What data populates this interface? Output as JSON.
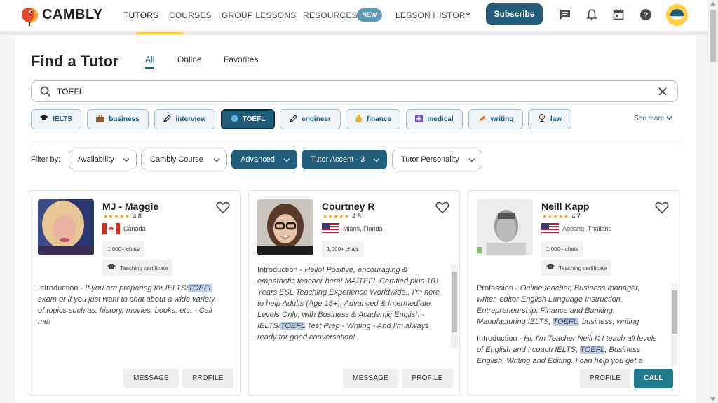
{
  "brand": {
    "name": "CAMBLY",
    "accent": "#1f5d7b",
    "yellow": "#ffce43"
  },
  "nav": {
    "items": [
      "TUTORS",
      "COURSES",
      "GROUP LESSONS",
      "RESOURCES",
      "LESSON HISTORY"
    ],
    "new_badge": "NEW",
    "subscribe": "Subscribe",
    "icons": [
      "chat-icon",
      "bell-icon",
      "calendar-icon",
      "help-icon",
      "profile-avatar"
    ]
  },
  "page": {
    "title": "Find a Tutor",
    "tabs": [
      "All",
      "Online",
      "Favorites"
    ]
  },
  "search": {
    "value": "TOEFL"
  },
  "chips": [
    "IELTS",
    "business",
    "interview",
    "TOEFL",
    "engineer",
    "finance",
    "medical",
    "writing",
    "law"
  ],
  "see_more": "See more",
  "filters": {
    "label": "Filter by:",
    "items": [
      "Availability",
      "Cambly Course",
      "Advanced",
      "Tutor Accent · 3",
      "Tutor Personality"
    ]
  },
  "tutors": [
    {
      "name": "MJ - Maggie",
      "rating": "4.8",
      "location": "Canada",
      "chats": "1,000+ chats",
      "cert": "Teaching certificate",
      "desc_label": "Introduction - ",
      "desc_a": "If you are preparing for IELTS/",
      "desc_hl": "TOEFL",
      "desc_b": " exam or if you just want to chat about a wide variety of topics such as: history, movies, books, etc. - Call me!",
      "btn1": "MESSAGE",
      "btn2": "PROFILE"
    },
    {
      "name": "Courtney R",
      "rating": "4.8",
      "location": "Miami, Florida",
      "chats": "1,000+ chats",
      "desc_label": "Introduction - ",
      "desc_a": "Hello! Positive, encouraging & empathetic teacher here! MA/TEFL Certified plus 10+ Years ESL Teaching Experience Worldwide.. I'm here to help Adults (Age 15+); Advanced & Intermediate Levels Only; with Business & Academic English - IELTS/",
      "desc_hl": "TOEFL",
      "desc_b": " Test Prep - Writing - And I'm always ready for good conversation!",
      "btn1": "MESSAGE",
      "btn2": "PROFILE"
    },
    {
      "name": "Neill Kapp",
      "rating": "4.7",
      "location": "Aonang, Thailand",
      "chats": "1,000+ chats",
      "cert": "Teaching certificate",
      "prof_label": "Profession - ",
      "prof_a": "Online teacher, Business manager, writer, editor English Language Instruction, Entrepreneurship, Finance and Banking, Manufacturing IELTS, ",
      "prof_hl": "TOEFL",
      "prof_b": ", business, writing",
      "desc_label": "Introduction - ",
      "desc_a": "Hi, I'm Teacher Neill K I teach all levels of English and I coach IELTS, ",
      "desc_hl": "TOEFL",
      "desc_b": ", Business English, Writing and Editing. I can help you get a",
      "btn1": "PROFILE",
      "btn2": "CALL"
    }
  ]
}
